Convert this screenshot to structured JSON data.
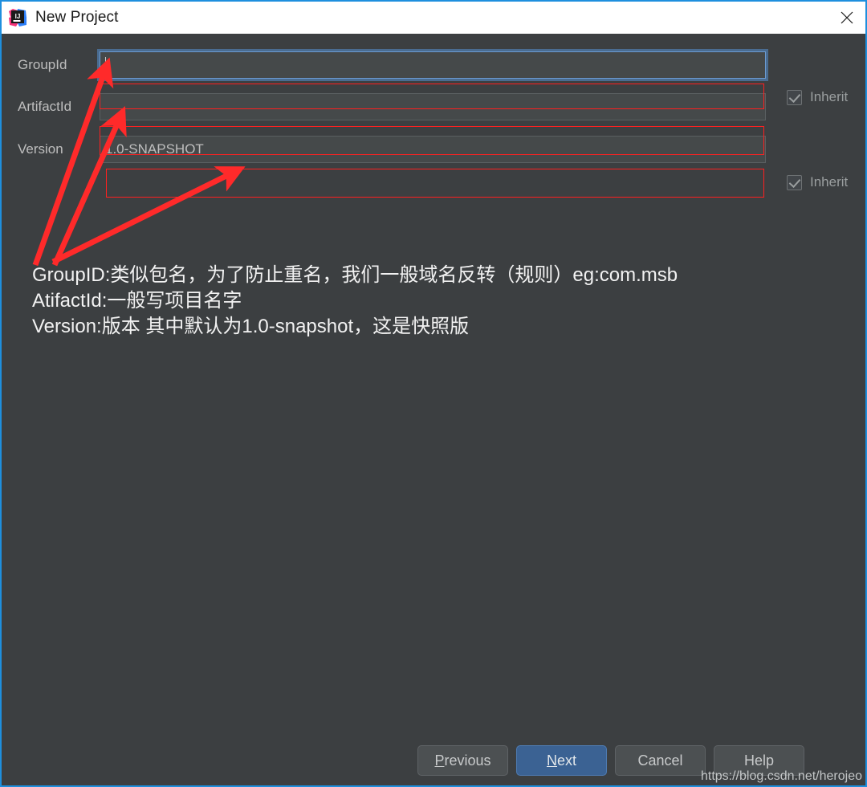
{
  "window": {
    "title": "New Project",
    "logo_text": "IJ",
    "close_label": "✕",
    "border_color": "#1E8FDE",
    "background_color": "#3C3F41"
  },
  "form": {
    "rows": [
      {
        "label": "GroupId",
        "value": "",
        "placeholder": "",
        "focused": true,
        "inherit_label": "Inherit",
        "inherit_checked": true,
        "has_inherit": true
      },
      {
        "label": "ArtifactId",
        "value": "",
        "placeholder": "",
        "focused": false,
        "inherit_label": "",
        "inherit_checked": false,
        "has_inherit": false
      },
      {
        "label": "Version",
        "value": "1.0-SNAPSHOT",
        "placeholder": "",
        "focused": false,
        "inherit_label": "Inherit",
        "inherit_checked": true,
        "has_inherit": true
      }
    ]
  },
  "annotation": {
    "color": "#FF2020",
    "lines": [
      "GroupID:类似包名，为了防止重名，我们一般域名反转（规则）eg:com.msb",
      "AtifactId:一般写项目名字",
      "Version:版本 其中默认为1.0-snapshot，这是快照版"
    ]
  },
  "footer": {
    "buttons": [
      {
        "label": "Previous",
        "mnemonic": "P",
        "primary": false
      },
      {
        "label": "Next",
        "mnemonic": "N",
        "primary": true
      },
      {
        "label": "Cancel",
        "mnemonic": "",
        "primary": false
      },
      {
        "label": "Help",
        "mnemonic": "",
        "primary": false
      }
    ]
  },
  "watermark": {
    "text": "https://blog.csdn.net/herojeo"
  }
}
